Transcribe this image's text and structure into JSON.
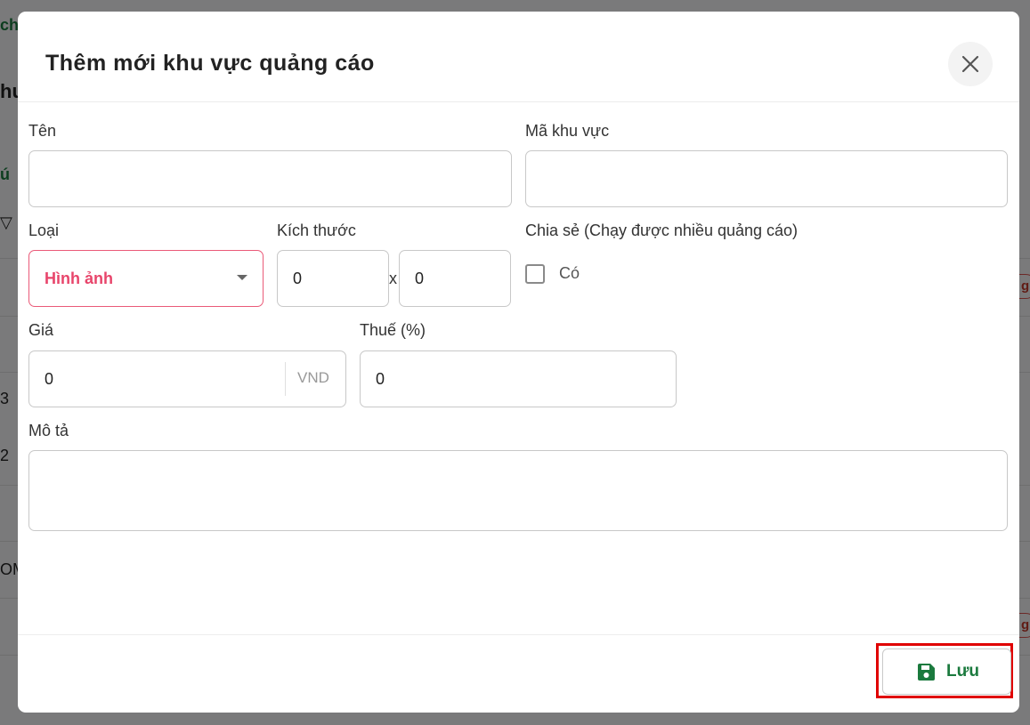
{
  "background": {
    "fragments": [
      "chú",
      "hu",
      "ú",
      "g",
      "3",
      "2",
      "OM",
      "g"
    ]
  },
  "modal": {
    "title": "Thêm mới khu vực quảng cáo",
    "close_icon": "close-icon"
  },
  "form": {
    "name": {
      "label": "Tên",
      "value": ""
    },
    "area_code": {
      "label": "Mã khu vực",
      "value": ""
    },
    "type": {
      "label": "Loại",
      "selected": "Hình ảnh"
    },
    "size": {
      "label": "Kích thước",
      "width": "0",
      "separator": "x",
      "height": "0"
    },
    "share": {
      "label": "Chia sẻ (Chạy được nhiều quảng cáo)",
      "option_label": "Có",
      "checked": false
    },
    "price": {
      "label": "Giá",
      "value": "0",
      "unit": "VND"
    },
    "tax": {
      "label": "Thuế (%)",
      "value": "0"
    },
    "description": {
      "label": "Mô tả",
      "value": ""
    }
  },
  "footer": {
    "save_label": "Lưu",
    "save_icon": "floppy-disk-icon"
  },
  "colors": {
    "brand_green": "#1b7a3e",
    "select_accent": "#e8456b",
    "highlight_red": "#e00000"
  }
}
